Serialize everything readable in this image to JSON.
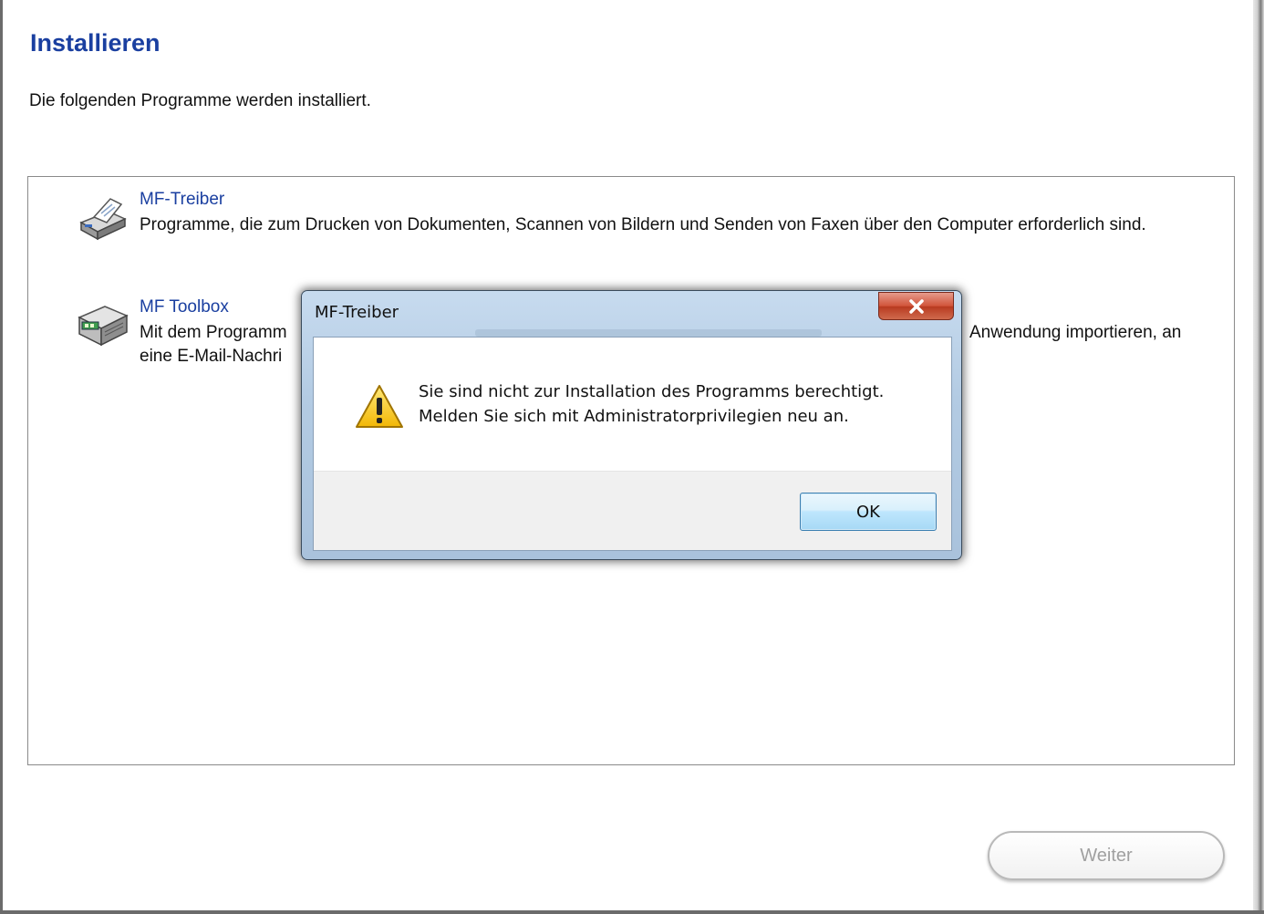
{
  "installer": {
    "title": "Installieren",
    "intro": "Die folgenden Programme werden installiert.",
    "programs": [
      {
        "name": "MF-Treiber",
        "description": "Programme, die zum Drucken von Dokumenten, Scannen von Bildern und Senden von Faxen über den Computer erforderlich sind.",
        "icon": "printer-icon"
      },
      {
        "name": "MF Toolbox",
        "description_left": "Mit dem Programm",
        "description_right": "Anwendung importieren, an",
        "description_line2": "eine E-Mail-Nachri",
        "icon": "fax-scanner-icon"
      }
    ],
    "next_button": "Weiter"
  },
  "dialog": {
    "title": "MF-Treiber",
    "message_line1": "Sie sind nicht zur Installation des Programms berechtigt.",
    "message_line2": "Melden Sie sich mit Administratorprivilegien neu an.",
    "ok_button": "OK",
    "icon": "warning-icon",
    "close_icon": "close-icon"
  },
  "colors": {
    "heading": "#1a3fa0",
    "close_button": "#c8452b",
    "ok_border": "#3c7fb1"
  }
}
